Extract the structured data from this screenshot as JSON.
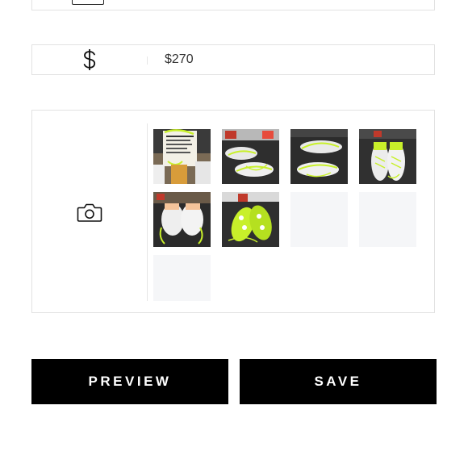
{
  "price": {
    "icon": "dollar-icon",
    "value": "$270"
  },
  "photos": {
    "icon": "camera-icon",
    "thumbnails": [
      {
        "kind": "photo",
        "subject": "shoe-box-label"
      },
      {
        "kind": "photo",
        "subject": "sneakers-side"
      },
      {
        "kind": "photo",
        "subject": "sneakers-pair-top"
      },
      {
        "kind": "photo",
        "subject": "sneakers-front"
      },
      {
        "kind": "photo",
        "subject": "sneakers-back"
      },
      {
        "kind": "photo",
        "subject": "sneakers-soles"
      },
      {
        "kind": "empty"
      },
      {
        "kind": "empty"
      },
      {
        "kind": "empty"
      }
    ]
  },
  "actions": {
    "preview_label": "PREVIEW",
    "save_label": "SAVE"
  },
  "colors": {
    "button_bg": "#000000",
    "button_text": "#ffffff",
    "border": "#e2e2e2",
    "placeholder": "#f5f6f8",
    "accent_lime": "#c8f02a"
  }
}
